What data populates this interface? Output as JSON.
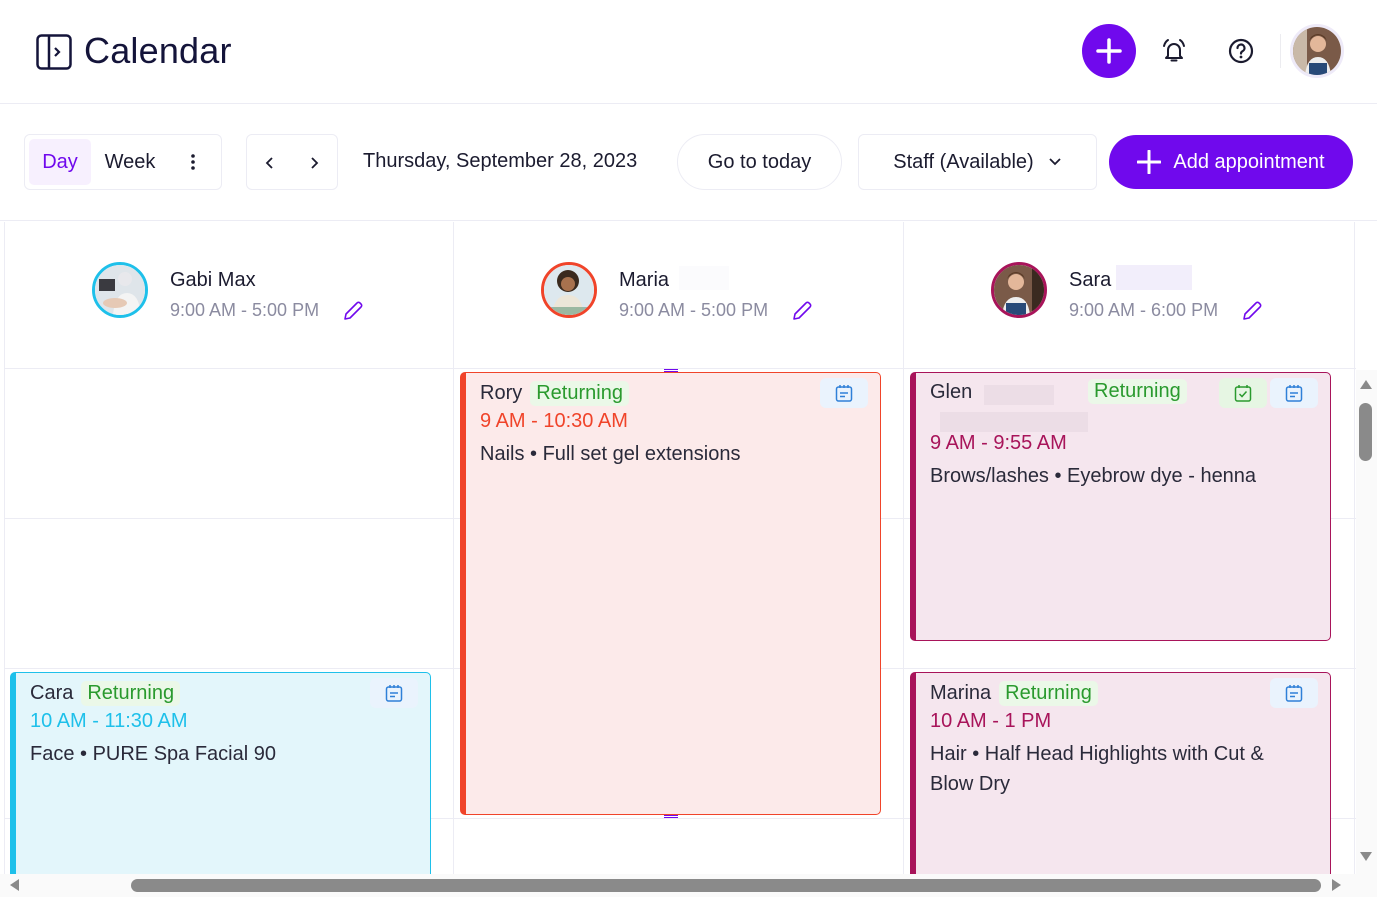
{
  "header": {
    "title": "Calendar",
    "icons": {
      "sidebar_toggle": "sidebar-expand-icon",
      "quick_add": "plus-icon",
      "notifications": "bell-icon",
      "help": "help-circle-icon"
    }
  },
  "toolbar": {
    "views": [
      {
        "label": "Day",
        "active": true
      },
      {
        "label": "Week",
        "active": false
      }
    ],
    "more_icon": "kebab-menu-icon",
    "prev_icon": "chevron-left-icon",
    "next_icon": "chevron-right-icon",
    "date": "Thursday, September 28, 2023",
    "go_to_today": "Go to today",
    "staff_filter": "Staff (Available)",
    "add_appointment": "Add appointment"
  },
  "colors": {
    "brand": "#7009ed",
    "gabi": "#1ec0ea",
    "maria": "#f0442a",
    "sara": "#a8145a",
    "returning_text": "#2a9a2e",
    "returning_bg": "#ebf8e8"
  },
  "staff": [
    {
      "name": "Gabi Max",
      "hours": "9:00 AM - 5:00 PM",
      "color": "#1ec0ea"
    },
    {
      "name": "Maria",
      "hours": "9:00 AM - 5:00 PM",
      "color": "#f0442a"
    },
    {
      "name": "Sara",
      "hours": "9:00 AM - 6:00 PM",
      "color": "#a8145a"
    }
  ],
  "appointments": [
    {
      "staff": "Maria",
      "client": "Rory",
      "badge": "Returning",
      "time": "9 AM - 10:30 AM",
      "service": "Nails • Full set gel extensions",
      "icons": [
        "notes-calendar-icon"
      ]
    },
    {
      "staff": "Sara",
      "client": "Glen",
      "badge": "Returning",
      "time": "9 AM - 9:55 AM",
      "service": "Brows/lashes • Eyebrow dye - henna",
      "icons": [
        "checked-in-icon",
        "notes-calendar-icon"
      ]
    },
    {
      "staff": "Gabi Max",
      "client": "Cara",
      "badge": "Returning",
      "time": "10 AM - 11:30 AM",
      "service": "Face • PURE Spa Facial 90",
      "icons": [
        "notes-calendar-icon"
      ]
    },
    {
      "staff": "Sara",
      "client": "Marina",
      "badge": "Returning",
      "time": "10 AM - 1 PM",
      "service": "Hair • Half Head Highlights with Cut & Blow Dry",
      "icons": [
        "notes-calendar-icon"
      ]
    }
  ]
}
